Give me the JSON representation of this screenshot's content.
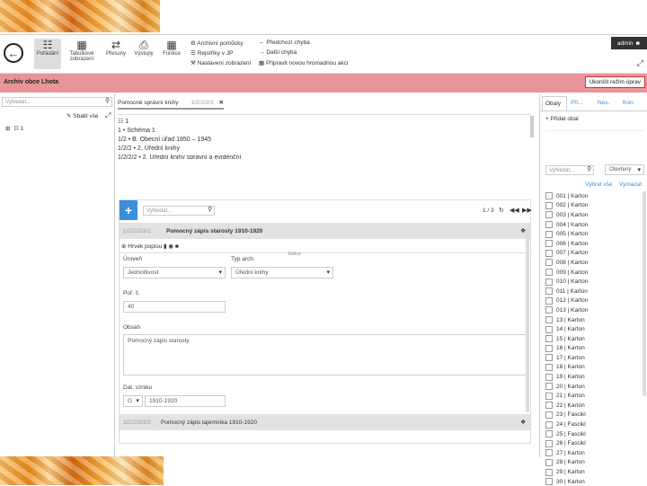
{
  "toolbar": {
    "buttons": [
      {
        "label": "Pořádání",
        "icon": "sitemap-icon"
      },
      {
        "label": "Tabulkové zobrazení",
        "icon": "table-icon"
      },
      {
        "label": "Přesuny",
        "icon": "exchange-icon"
      },
      {
        "label": "Výstupy",
        "icon": "print-icon"
      },
      {
        "label": "Funkce",
        "icon": "calculator-icon"
      }
    ],
    "links": [
      "Archivní pomůcky",
      "Rejstříky v JP",
      "Nastavení zobrazení",
      "Předchozí chyba",
      "Další chyba",
      "Připravit novou hromadnou akci"
    ],
    "user": "admin"
  },
  "banner": {
    "title": "Archiv obce Lhota",
    "button": "Ukončit režim úprav"
  },
  "left": {
    "search_placeholder": "Vyhledat...",
    "collapse": "Sbalit vše",
    "tree_root": "1"
  },
  "mid": {
    "tab_label": "Pomocné správní knihy",
    "tab_code": "1/2/2/2/3",
    "tree": [
      "1",
      "1 • Schéma 1",
      "1/2 • B. Obecní úřad 1850 – 1945",
      "1/2/2 • 2. Úřední knihy",
      "1/2/2/2 • 2. Úřední knihy správní a evidenční"
    ],
    "search_placeholder": "Vyhledat...",
    "pager": "1 / 3",
    "record1_code": "1/2/2/2/3/1",
    "record1_title": "Pomocný zápis starosty 1910-1920",
    "add_desc": "Hrvek popisu",
    "level_label": "Úroveň",
    "level_value": "Jednotlivost",
    "type_label": "Typ arch.",
    "type_value": "Úřední knihy",
    "edition_label": "Edice",
    "pos_label": "Poř. č.",
    "pos_value": "40",
    "content_label": "Obsah",
    "content_value": "Pomocný zápis starosty",
    "date_label": "Dat. vzniku",
    "date_prefix": "G",
    "date_value": "1910-1920",
    "record2_code": "1/2/2/2/3/2",
    "record2_title": "Pomocný zápis tajemníka 1910-1920"
  },
  "right": {
    "tabs": [
      "Obaly",
      "Při...",
      "Nes.",
      "Kon."
    ],
    "add_label": "Přidat obal",
    "search_placeholder": "Vyhledat...",
    "filter": "Otevřený",
    "select_all": "Vybrat vše",
    "deselect": "Vymazat",
    "boxes": [
      "001 | Karton",
      "002 | Karton",
      "003 | Karton",
      "004 | Karton",
      "005 | Karton",
      "006 | Karton",
      "007 | Karton",
      "008 | Karton",
      "009 | Karton",
      "010 | Karton",
      "011 | Karton",
      "012 | Karton",
      "013 | Karton",
      "13 | Karton",
      "14 | Karton",
      "15 | Karton",
      "16 | Karton",
      "17 | Karton",
      "18 | Karton",
      "19 | Karton",
      "20 | Karton",
      "21 | Karton",
      "22 | Karton",
      "23 | Fascikl",
      "24 | Fascikl",
      "25 | Fascikl",
      "26 | Fascikl",
      "27 | Karton",
      "28 | Karton",
      "29 | Karton",
      "30 | Karton"
    ]
  },
  "colors": {
    "banner": "#e8959a",
    "accent": "#3a8fd8"
  }
}
